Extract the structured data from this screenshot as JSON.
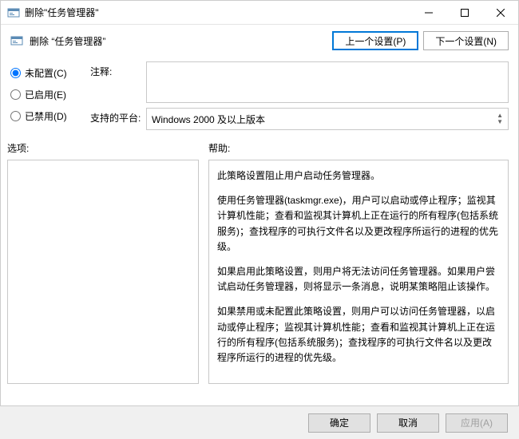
{
  "window": {
    "title": "删除\"任务管理器\""
  },
  "header": {
    "title": "删除 “任务管理器”",
    "prev_btn": "上一个设置(P)",
    "next_btn": "下一个设置(N)"
  },
  "radios": {
    "not_configured": "未配置(C)",
    "enabled": "已启用(E)",
    "disabled": "已禁用(D)"
  },
  "fields": {
    "comment_label": "注释:",
    "comment_value": "",
    "platform_label": "支持的平台:",
    "platform_value": "Windows 2000 及以上版本"
  },
  "lower": {
    "options_label": "选项:",
    "help_label": "帮助:",
    "help_paragraphs": [
      "此策略设置阻止用户启动任务管理器。",
      "使用任务管理器(taskmgr.exe)，用户可以启动或停止程序；监视其计算机性能；查看和监视其计算机上正在运行的所有程序(包括系统服务)；查找程序的可执行文件名以及更改程序所运行的进程的优先级。",
      "如果启用此策略设置，则用户将无法访问任务管理器。如果用户尝试启动任务管理器，则将显示一条消息，说明某策略阻止该操作。",
      "如果禁用或未配置此策略设置，则用户可以访问任务管理器，以启动或停止程序；监视其计算机性能；查看和监视其计算机上正在运行的所有程序(包括系统服务)；查找程序的可执行文件名以及更改程序所运行的进程的优先级。"
    ]
  },
  "footer": {
    "ok": "确定",
    "cancel": "取消",
    "apply": "应用(A)"
  }
}
